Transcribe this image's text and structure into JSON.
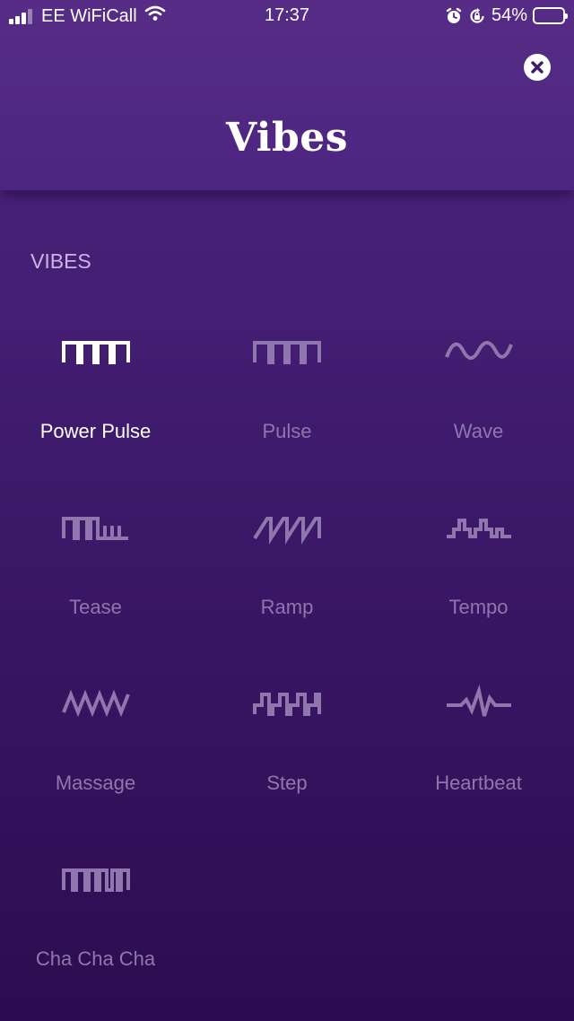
{
  "status_bar": {
    "carrier": "EE WiFiCall",
    "time": "17:37",
    "battery_percent": "54%",
    "battery_level": 0.54
  },
  "header": {
    "title": "Vibes",
    "close_icon": "close-circle-icon"
  },
  "section": {
    "title": "VIBES"
  },
  "vibes": [
    {
      "label": "Power Pulse",
      "icon": "power-pulse-icon",
      "active": true
    },
    {
      "label": "Pulse",
      "icon": "pulse-icon",
      "active": false
    },
    {
      "label": "Wave",
      "icon": "wave-icon",
      "active": false
    },
    {
      "label": "Tease",
      "icon": "tease-icon",
      "active": false
    },
    {
      "label": "Ramp",
      "icon": "ramp-icon",
      "active": false
    },
    {
      "label": "Tempo",
      "icon": "tempo-icon",
      "active": false
    },
    {
      "label": "Massage",
      "icon": "massage-icon",
      "active": false
    },
    {
      "label": "Step",
      "icon": "step-icon",
      "active": false
    },
    {
      "label": "Heartbeat",
      "icon": "heartbeat-icon",
      "active": false
    },
    {
      "label": "Cha Cha Cha",
      "icon": "cha-cha-cha-icon",
      "active": false
    }
  ],
  "colors": {
    "active": "#ffffff",
    "inactive": "#8f77ad",
    "section_title": "#c9b6e4",
    "background_top": "#4f2680",
    "background_bottom": "#2c0c50"
  }
}
